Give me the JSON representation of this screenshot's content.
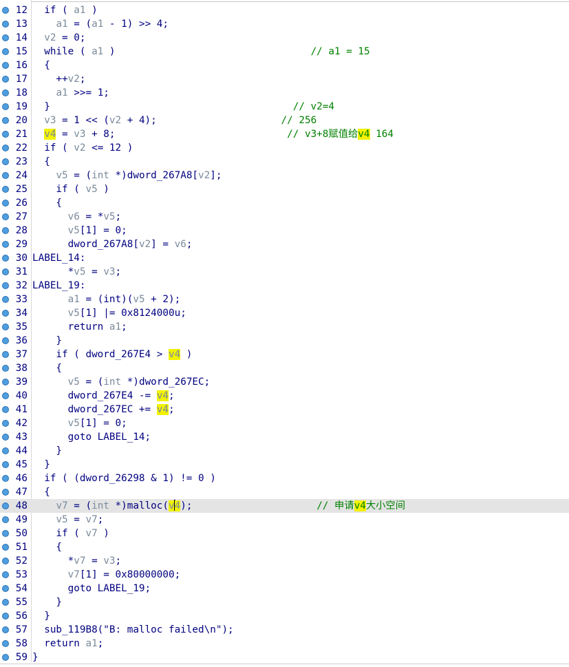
{
  "editor": {
    "highlight_color": "#f2f200",
    "lines": [
      {
        "n": "12",
        "tokens": [
          [
            "  if ( ",
            ""
          ],
          [
            "a1",
            "v"
          ],
          [
            " )",
            ""
          ]
        ]
      },
      {
        "n": "13",
        "tokens": [
          [
            "    ",
            ""
          ],
          [
            "a1",
            "v"
          ],
          [
            " = (",
            ""
          ],
          [
            "a1",
            "v"
          ],
          [
            " - 1) >> 4;",
            ""
          ]
        ]
      },
      {
        "n": "14",
        "tokens": [
          [
            "  ",
            ""
          ],
          [
            "v2",
            "v"
          ],
          [
            " = 0;",
            ""
          ]
        ]
      },
      {
        "n": "15",
        "tokens": [
          [
            "  while ( ",
            ""
          ],
          [
            "a1",
            "v"
          ],
          [
            " )                                 ",
            ""
          ],
          [
            "// a1 = 15",
            "c"
          ]
        ]
      },
      {
        "n": "16",
        "tokens": [
          [
            "  {",
            ""
          ]
        ]
      },
      {
        "n": "17",
        "tokens": [
          [
            "    ++",
            ""
          ],
          [
            "v2",
            "v"
          ],
          [
            ";",
            ""
          ]
        ]
      },
      {
        "n": "18",
        "tokens": [
          [
            "    ",
            ""
          ],
          [
            "a1",
            "v"
          ],
          [
            " >>= 1;",
            ""
          ]
        ]
      },
      {
        "n": "19",
        "tokens": [
          [
            "  }                                         ",
            ""
          ],
          [
            "// v2=4",
            "c"
          ]
        ]
      },
      {
        "n": "20",
        "tokens": [
          [
            "  ",
            ""
          ],
          [
            "v3",
            "v"
          ],
          [
            " = 1 << (",
            ""
          ],
          [
            "v2",
            "v"
          ],
          [
            " + 4);                     ",
            ""
          ],
          [
            "// 256",
            "c"
          ]
        ]
      },
      {
        "n": "21",
        "tokens": [
          [
            "  ",
            ""
          ],
          [
            "v4",
            "vh"
          ],
          [
            " = ",
            ""
          ],
          [
            "v3",
            "v"
          ],
          [
            " + 8;                             ",
            ""
          ],
          [
            "// v3+8赋值给",
            "c"
          ],
          [
            "v4",
            "ch"
          ],
          [
            " 164",
            "c"
          ]
        ]
      },
      {
        "n": "22",
        "tokens": [
          [
            "  if ( ",
            ""
          ],
          [
            "v2",
            "v"
          ],
          [
            " <= 12 )",
            ""
          ]
        ]
      },
      {
        "n": "23",
        "tokens": [
          [
            "  {",
            ""
          ]
        ]
      },
      {
        "n": "24",
        "tokens": [
          [
            "    ",
            ""
          ],
          [
            "v5",
            "v"
          ],
          [
            " = (",
            ""
          ],
          [
            "int",
            "v"
          ],
          [
            " *)dword_267A8[",
            ""
          ],
          [
            "v2",
            "v"
          ],
          [
            "];",
            ""
          ]
        ]
      },
      {
        "n": "25",
        "tokens": [
          [
            "    if ( ",
            ""
          ],
          [
            "v5",
            "v"
          ],
          [
            " )",
            ""
          ]
        ]
      },
      {
        "n": "26",
        "tokens": [
          [
            "    {",
            ""
          ]
        ]
      },
      {
        "n": "27",
        "tokens": [
          [
            "      ",
            ""
          ],
          [
            "v6",
            "v"
          ],
          [
            " = *",
            ""
          ],
          [
            "v5",
            "v"
          ],
          [
            ";",
            ""
          ]
        ]
      },
      {
        "n": "28",
        "tokens": [
          [
            "      ",
            ""
          ],
          [
            "v5",
            "v"
          ],
          [
            "[1] = 0;",
            ""
          ]
        ]
      },
      {
        "n": "29",
        "tokens": [
          [
            "      dword_267A8[",
            ""
          ],
          [
            "v2",
            "v"
          ],
          [
            "] = ",
            ""
          ],
          [
            "v6",
            "v"
          ],
          [
            ";",
            ""
          ]
        ]
      },
      {
        "n": "30",
        "tokens": [
          [
            "LABEL_14:",
            ""
          ]
        ]
      },
      {
        "n": "31",
        "tokens": [
          [
            "      *",
            ""
          ],
          [
            "v5",
            "v"
          ],
          [
            " = ",
            ""
          ],
          [
            "v3",
            "v"
          ],
          [
            ";",
            ""
          ]
        ]
      },
      {
        "n": "32",
        "tokens": [
          [
            "LABEL_19:",
            ""
          ]
        ]
      },
      {
        "n": "33",
        "tokens": [
          [
            "      ",
            ""
          ],
          [
            "a1",
            "v"
          ],
          [
            " = (int)(",
            ""
          ],
          [
            "v5",
            "v"
          ],
          [
            " + 2);",
            ""
          ]
        ]
      },
      {
        "n": "34",
        "tokens": [
          [
            "      ",
            ""
          ],
          [
            "v5",
            "v"
          ],
          [
            "[1] |= 0x8124000u;",
            ""
          ]
        ]
      },
      {
        "n": "35",
        "tokens": [
          [
            "      return ",
            ""
          ],
          [
            "a1",
            "v"
          ],
          [
            ";",
            ""
          ]
        ]
      },
      {
        "n": "36",
        "tokens": [
          [
            "    }",
            ""
          ]
        ]
      },
      {
        "n": "37",
        "tokens": [
          [
            "    if ( dword_267E4 > ",
            ""
          ],
          [
            "v4",
            "vh"
          ],
          [
            " )",
            ""
          ]
        ]
      },
      {
        "n": "38",
        "tokens": [
          [
            "    {",
            ""
          ]
        ]
      },
      {
        "n": "39",
        "tokens": [
          [
            "      ",
            ""
          ],
          [
            "v5",
            "v"
          ],
          [
            " = (",
            ""
          ],
          [
            "int",
            "v"
          ],
          [
            " *)dword_267EC;",
            ""
          ]
        ]
      },
      {
        "n": "40",
        "tokens": [
          [
            "      dword_267E4 -= ",
            ""
          ],
          [
            "v4",
            "vh"
          ],
          [
            ";",
            ""
          ]
        ]
      },
      {
        "n": "41",
        "tokens": [
          [
            "      dword_267EC += ",
            ""
          ],
          [
            "v4",
            "vh"
          ],
          [
            ";",
            ""
          ]
        ]
      },
      {
        "n": "42",
        "tokens": [
          [
            "      ",
            ""
          ],
          [
            "v5",
            "v"
          ],
          [
            "[1] = 0;",
            ""
          ]
        ]
      },
      {
        "n": "43",
        "tokens": [
          [
            "      goto LABEL_14;",
            ""
          ]
        ]
      },
      {
        "n": "44",
        "tokens": [
          [
            "    }",
            ""
          ]
        ]
      },
      {
        "n": "45",
        "tokens": [
          [
            "  }",
            ""
          ]
        ]
      },
      {
        "n": "46",
        "tokens": [
          [
            "  if ( (dword_26298 & 1) != 0 )",
            ""
          ]
        ]
      },
      {
        "n": "47",
        "tokens": [
          [
            "  {",
            ""
          ]
        ]
      },
      {
        "n": "48",
        "current": true,
        "tokens": [
          [
            "    ",
            ""
          ],
          [
            "v7",
            "v"
          ],
          [
            " = (",
            ""
          ],
          [
            "int",
            "v"
          ],
          [
            " *)malloc(",
            ""
          ],
          [
            "v",
            "vh"
          ],
          [
            "|",
            "caret"
          ],
          [
            "4",
            "vh"
          ],
          [
            ");                     ",
            ""
          ],
          [
            "// 申请",
            "c"
          ],
          [
            "v4",
            "ch"
          ],
          [
            "大小空间",
            "c"
          ]
        ]
      },
      {
        "n": "49",
        "tokens": [
          [
            "    ",
            ""
          ],
          [
            "v5",
            "v"
          ],
          [
            " = ",
            ""
          ],
          [
            "v7",
            "v"
          ],
          [
            ";",
            ""
          ]
        ]
      },
      {
        "n": "50",
        "tokens": [
          [
            "    if ( ",
            ""
          ],
          [
            "v7",
            "v"
          ],
          [
            " )",
            ""
          ]
        ]
      },
      {
        "n": "51",
        "tokens": [
          [
            "    {",
            ""
          ]
        ]
      },
      {
        "n": "52",
        "tokens": [
          [
            "      *",
            ""
          ],
          [
            "v7",
            "v"
          ],
          [
            " = ",
            ""
          ],
          [
            "v3",
            "v"
          ],
          [
            ";",
            ""
          ]
        ]
      },
      {
        "n": "53",
        "tokens": [
          [
            "      ",
            ""
          ],
          [
            "v7",
            "v"
          ],
          [
            "[1] = 0x80000000;",
            ""
          ]
        ]
      },
      {
        "n": "54",
        "tokens": [
          [
            "      goto LABEL_19;",
            ""
          ]
        ]
      },
      {
        "n": "55",
        "tokens": [
          [
            "    }",
            ""
          ]
        ]
      },
      {
        "n": "56",
        "tokens": [
          [
            "  }",
            ""
          ]
        ]
      },
      {
        "n": "57",
        "tokens": [
          [
            "  sub_119B8(\"B: malloc failed\\n\");",
            ""
          ]
        ]
      },
      {
        "n": "58",
        "tokens": [
          [
            "  return ",
            ""
          ],
          [
            "a1",
            "v"
          ],
          [
            ";",
            ""
          ]
        ]
      },
      {
        "n": "59",
        "tokens": [
          [
            "}",
            ""
          ]
        ]
      }
    ]
  }
}
